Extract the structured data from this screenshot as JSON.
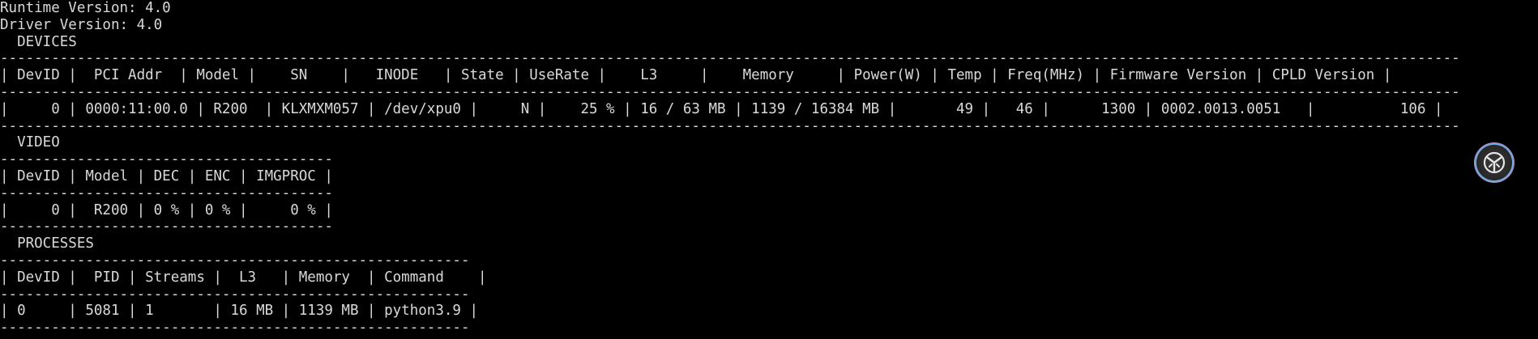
{
  "header": {
    "runtime": "Runtime Version: 4.0",
    "driver": "Driver Version: 4.0"
  },
  "devices": {
    "title": "  DEVICES",
    "separator": "---------------------------------------------------------------------------------------------------------------------------------------------------------------------------",
    "header_row": "| DevID |  PCI Addr  | Model |    SN    |   INODE   | State | UseRate |    L3     |    Memory     | Power(W) | Temp | Freq(MHz) | Firmware Version | CPLD Version |",
    "row": "|     0 | 0000:11:00.0 | R200  | KLXMXM057 | /dev/xpu0 |     N |    25 % | 16 / 63 MB | 1139 / 16384 MB |       49 |   46 |      1300 | 0002.0013.0051   |          106 |"
  },
  "video": {
    "title": "  VIDEO",
    "separator": "---------------------------------------",
    "header_row": "| DevID | Model | DEC | ENC | IMGPROC |",
    "row": "|     0 |  R200 | 0 % | 0 % |     0 % |"
  },
  "processes": {
    "title": "  PROCESSES",
    "separator": "-------------------------------------------------------",
    "header_row": "| DevID |  PID | Streams |  L3   | Memory  | Command    |",
    "row": "| 0     | 5081 | 1       | 16 MB | 1139 MB | python3.9 |"
  },
  "badge": {
    "icon": "assistant-logo-icon",
    "ring_colors": [
      "#6fa9d8",
      "#b389c9"
    ]
  }
}
